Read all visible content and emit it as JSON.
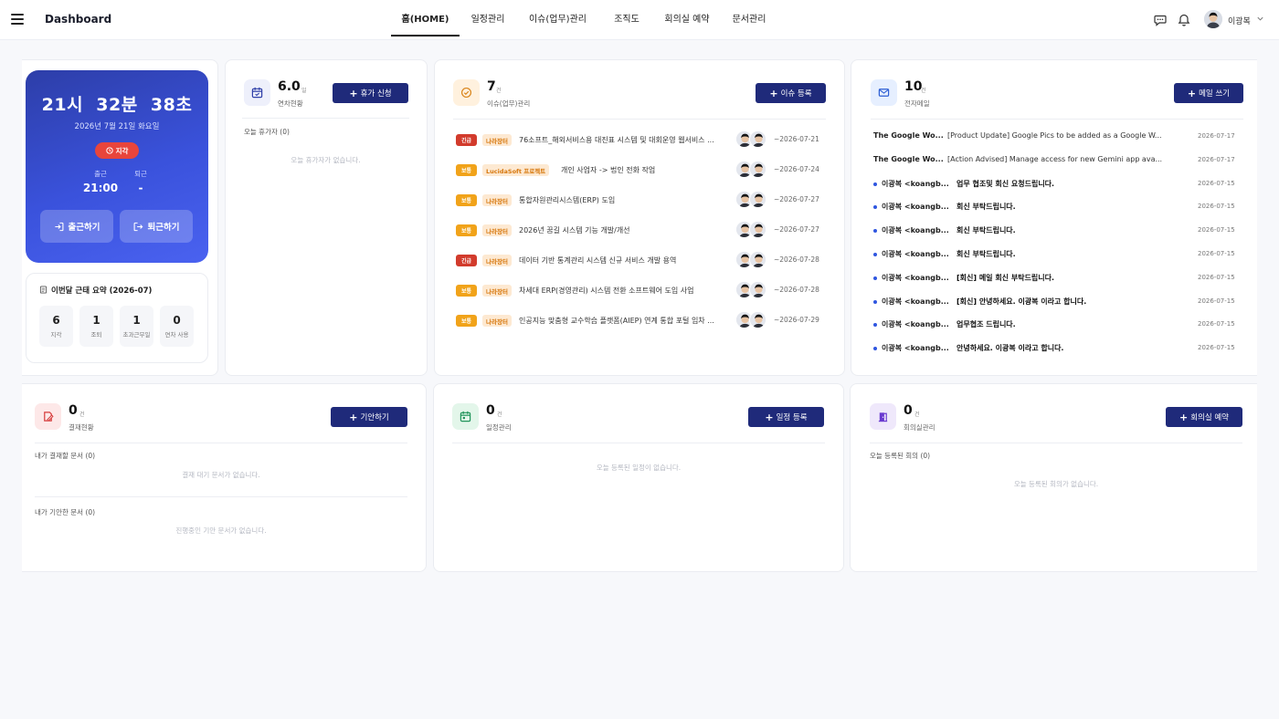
{
  "header": {
    "brand": "Dashboard",
    "nav": [
      {
        "label": "홈(HOME)",
        "active": true
      },
      {
        "label": "일정관리"
      },
      {
        "label": "이슈(업무)관리"
      },
      {
        "label": "조직도"
      },
      {
        "label": "회의실 예약"
      },
      {
        "label": "문서관리"
      }
    ],
    "user_name": "이광복"
  },
  "clock": {
    "time": "21시  32분  38초",
    "date": "2026년 7월 21일 화요일",
    "status_badge": "지각",
    "in_label": "출근",
    "out_label": "퇴근",
    "in_value": "21:00",
    "out_value": "-",
    "checkin_button": "출근하기",
    "checkout_button": "퇴근하기"
  },
  "summary": {
    "title": "이번달 근태 요약 (2026-07)",
    "items": [
      {
        "value": "6",
        "label": "지각"
      },
      {
        "value": "1",
        "label": "조퇴"
      },
      {
        "value": "1",
        "label": "초과근무일"
      },
      {
        "value": "0",
        "label": "연차 사용"
      }
    ]
  },
  "leave": {
    "count": "6.0",
    "unit": "일",
    "subtitle": "연차현황",
    "button": "휴가 신청",
    "today_label": "오늘 휴가자 (0)",
    "empty": "오늘 휴가자가 없습니다."
  },
  "issues": {
    "count": "7",
    "unit": "건",
    "subtitle": "이슈(업무)관리",
    "button": "이슈 등록",
    "rows": [
      {
        "priority": "긴급",
        "level": "urgent",
        "org": "나라장터",
        "title": "76소프트_해외서비스용 대진표 시스템 및 대회운영 웹서비스 ...",
        "date": "~2026-07-21"
      },
      {
        "priority": "보통",
        "level": "normal",
        "org": "LucidaSoft 프로젝트",
        "title": "개인 사업자 -> 법인 전화 작업",
        "date": "~2026-07-24"
      },
      {
        "priority": "보통",
        "level": "normal",
        "org": "나라장터",
        "title": "통합자원관리시스템(ERP) 도입",
        "date": "~2026-07-27"
      },
      {
        "priority": "보통",
        "level": "normal",
        "org": "나라장터",
        "title": "2026년 꿈길 시스템 기능 개발/개선",
        "date": "~2026-07-27"
      },
      {
        "priority": "긴급",
        "level": "urgent",
        "org": "나라장터",
        "title": "데이터 기반 통계관리 시스템 신규 서비스 개발 용역",
        "date": "~2026-07-28"
      },
      {
        "priority": "보통",
        "level": "normal",
        "org": "나라장터",
        "title": "차세대 ERP(경영관리) 시스템 전환 소프트웨어 도입 사업",
        "date": "~2026-07-28"
      },
      {
        "priority": "보통",
        "level": "normal",
        "org": "나라장터",
        "title": "인공지능 맞춤형 교수학습 플랫폼(AIEP) 연계 통합 포털 임차 ...",
        "date": "~2026-07-29"
      }
    ]
  },
  "mail": {
    "count": "10",
    "unit": "건",
    "subtitle": "전자메일",
    "button": "메일 쓰기",
    "rows": [
      {
        "sender": "The Google Wo...",
        "subject": "[Product Update] Google Pics to be added as a Google W...",
        "date": "2026-07-17",
        "unread": false
      },
      {
        "sender": "The Google Wo...",
        "subject": "[Action Advised] Manage access for new Gemini app ava...",
        "date": "2026-07-17",
        "unread": false
      },
      {
        "sender": "이광복 <koangb...",
        "subject": "업무 협조및 회신 요청드립니다.",
        "date": "2026-07-15",
        "unread": true
      },
      {
        "sender": "이광복 <koangb...",
        "subject": "회신 부탁드립니다.",
        "date": "2026-07-15",
        "unread": true
      },
      {
        "sender": "이광복 <koangb...",
        "subject": "회신 부탁드립니다.",
        "date": "2026-07-15",
        "unread": true
      },
      {
        "sender": "이광복 <koangb...",
        "subject": "회신 부탁드립니다.",
        "date": "2026-07-15",
        "unread": true
      },
      {
        "sender": "이광복 <koangb...",
        "subject": "[회신] 메일 회신 부탁드립니다.",
        "date": "2026-07-15",
        "unread": true
      },
      {
        "sender": "이광복 <koangb...",
        "subject": "[회신] 안녕하세요. 이광복 이라고 합니다.",
        "date": "2026-07-15",
        "unread": true
      },
      {
        "sender": "이광복 <koangb...",
        "subject": "업무협조 드립니다.",
        "date": "2026-07-15",
        "unread": true
      },
      {
        "sender": "이광복 <koangb...",
        "subject": "안녕하세요. 이광복 이라고 합니다.",
        "date": "2026-07-15",
        "unread": true
      }
    ]
  },
  "approval": {
    "count": "0",
    "unit": "건",
    "subtitle": "결재현황",
    "button": "기안하기",
    "to_approve_label": "내가 결재할 문서 (0)",
    "to_approve_empty": "결재 대기 문서가 없습니다.",
    "drafted_label": "내가 기안한 문서 (0)",
    "drafted_empty": "진행중인 기안 문서가 없습니다."
  },
  "schedule": {
    "count": "0",
    "unit": "건",
    "subtitle": "일정관리",
    "button": "일정 등록",
    "empty": "오늘 등록된 일정이 없습니다."
  },
  "meeting": {
    "count": "0",
    "unit": "건",
    "subtitle": "회의실관리",
    "button": "회의실 예약",
    "today_label": "오늘 등록된 회의 (0)",
    "empty": "오늘 등록된 회의가 없습니다."
  },
  "colors": {
    "primary_button": "#1f2a7a",
    "clock_gradient_start": "#2d3ea8",
    "clock_gradient_end": "#4a62f0",
    "urgent": "#d23b2c",
    "normal": "#f1a31a",
    "org_tag_bg": "#fde9d2",
    "unread_dot": "#2f56e0"
  }
}
